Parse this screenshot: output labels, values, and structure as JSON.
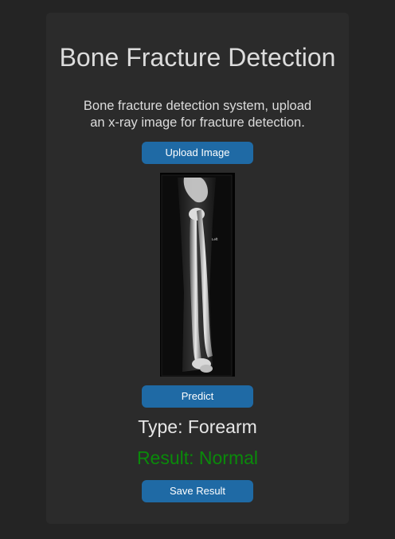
{
  "app": {
    "title": "Bone Fracture Detection",
    "description": "Bone fracture detection system, upload an x-ray image for fracture detection."
  },
  "buttons": {
    "upload": "Upload Image",
    "predict": "Predict",
    "save": "Save Result"
  },
  "xray": {
    "side_marker": "Left"
  },
  "prediction": {
    "type_text": "Type: Forearm",
    "result_text": "Result: Normal"
  },
  "colors": {
    "background": "#242424",
    "frame": "#2b2b2b",
    "button": "#1f6aa5",
    "result_normal": "#0a8a0a",
    "text": "#dcdcdc"
  }
}
